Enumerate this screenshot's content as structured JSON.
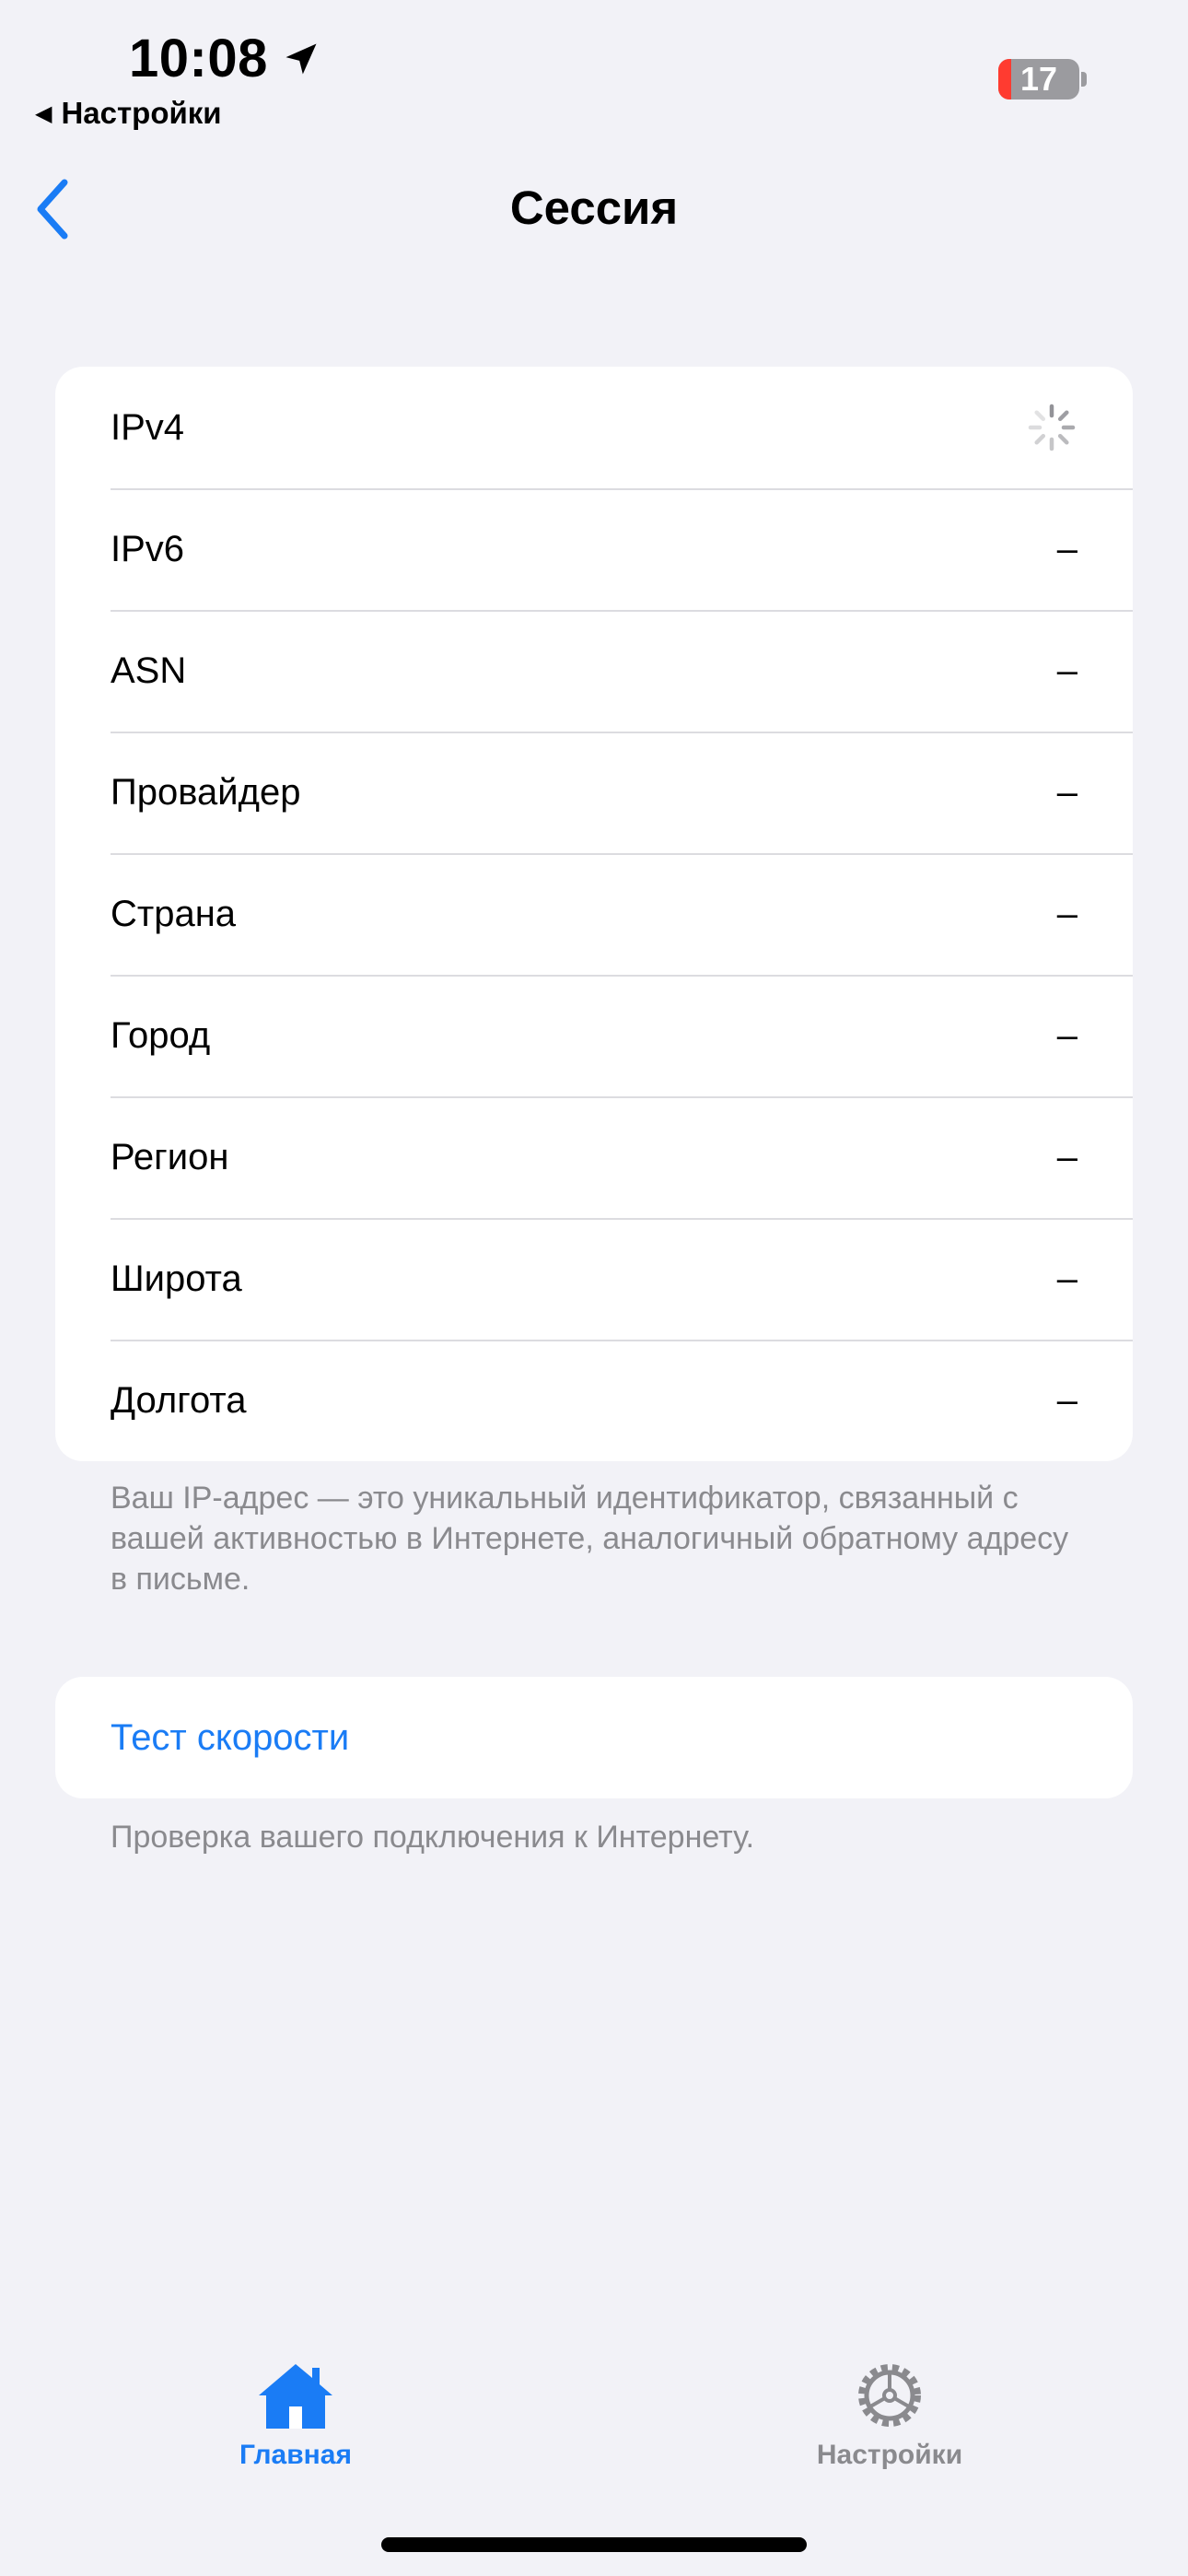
{
  "status_bar": {
    "time": "10:08",
    "back_app": "Настройки",
    "battery": "17"
  },
  "nav": {
    "title": "Сессия"
  },
  "info_rows": [
    {
      "label": "IPv4",
      "value": ""
    },
    {
      "label": "IPv6",
      "value": "–"
    },
    {
      "label": "ASN",
      "value": "–"
    },
    {
      "label": "Провайдер",
      "value": "–"
    },
    {
      "label": "Страна",
      "value": "–"
    },
    {
      "label": "Город",
      "value": "–"
    },
    {
      "label": "Регион",
      "value": "–"
    },
    {
      "label": "Широта",
      "value": "–"
    },
    {
      "label": "Долгота",
      "value": "–"
    }
  ],
  "info_footer": "Ваш IP-адрес — это уникальный идентификатор, связанный с вашей активностью в Интернете, аналогичный обратному адресу в письме.",
  "speed_test": {
    "label": "Тест скорости",
    "footer": "Проверка вашего подключения к Интернету."
  },
  "tab_bar": {
    "items": [
      {
        "label": "Главная",
        "icon": "house-icon",
        "active": true
      },
      {
        "label": "Настройки",
        "icon": "gear-icon",
        "active": false
      }
    ]
  },
  "colors": {
    "accent": "#1a7cf5",
    "background": "#f2f2f7",
    "secondary_text": "#8a8a8e",
    "battery_low": "#ff3b30"
  }
}
